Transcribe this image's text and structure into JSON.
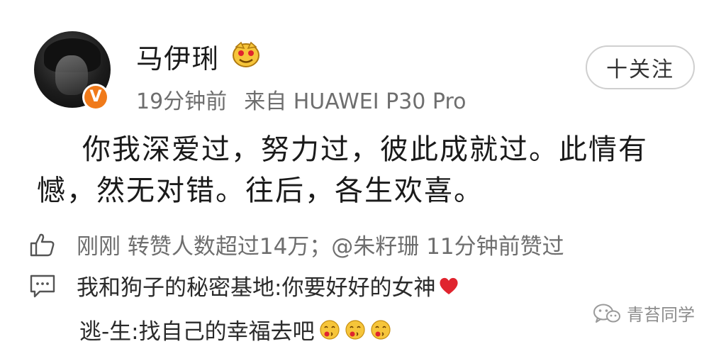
{
  "post": {
    "user": {
      "name": "马伊琍",
      "verified_badge": "V"
    },
    "time": "19分钟前",
    "source": "来自 HUAWEI P30 Pro",
    "follow_label": "十关注",
    "text": "你我深爱过，努力过，彼此成就过。此情有憾，然无对错。往后，各生欢喜。"
  },
  "stats": {
    "like_line": "刚刚 转赞人数超过14万；@朱籽珊 11分钟前赞过"
  },
  "comments": [
    {
      "text": "我和狗子的秘密基地:你要好好的女神"
    },
    {
      "text": "逃-生:找自己的幸福去吧"
    }
  ],
  "watermark": {
    "label": "青苔同学"
  },
  "colors": {
    "badge_orange": "#f07a1a",
    "meta_gray": "#6e6e6e",
    "heart_red": "#e0242e",
    "emoji_yellow": "#f6c53a"
  },
  "icons": {
    "like": "thumbs-up-icon",
    "comment": "comment-bubble-icon",
    "watermark": "wechat-icon"
  }
}
